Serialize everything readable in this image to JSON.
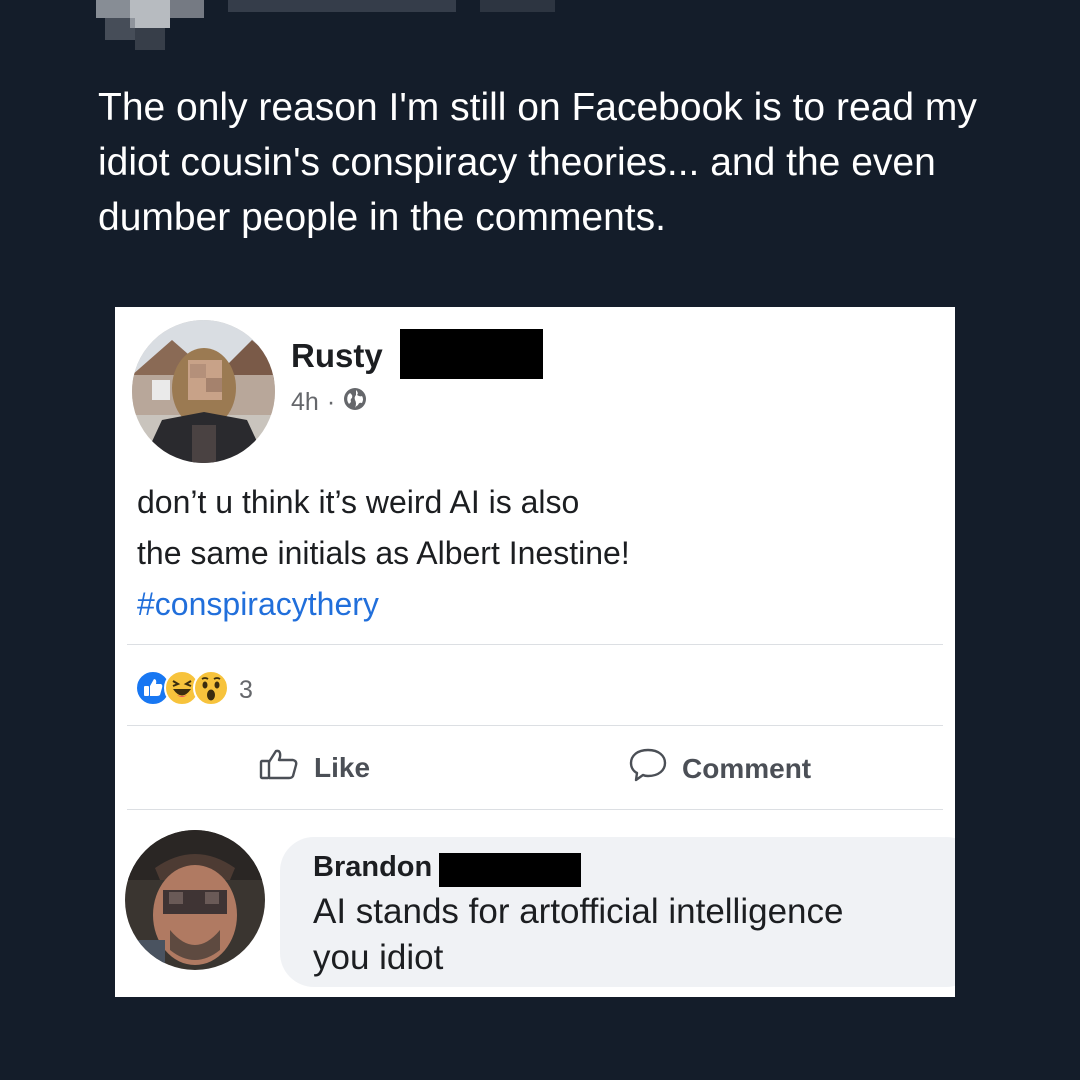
{
  "tweet": {
    "text": "The only reason I'm still on Facebook is to read my idiot cousin's conspiracy theories... and the even dumber people in the comments."
  },
  "post": {
    "author": "Rusty",
    "time": "4h",
    "separator": "·",
    "audience_icon": "globe-icon",
    "body_line1": "don’t u think it’s weird AI is also",
    "body_line2": "the same initials as Albert Inestine!",
    "hashtag": "#conspiracythery",
    "reaction_icons": [
      "like-reaction-icon",
      "haha-reaction-icon",
      "wow-reaction-icon"
    ],
    "reaction_count": "3",
    "like_label": "Like",
    "comment_label": "Comment"
  },
  "comment": {
    "author": "Brandon",
    "text_line1": "AI stands for artofficial intelligence",
    "text_line2": "you idiot"
  },
  "colors": {
    "background": "#141d2a",
    "card": "#ffffff",
    "hashtag": "#216fdb",
    "like_blue": "#1877f2",
    "emoji_yellow": "#f7c33c"
  }
}
